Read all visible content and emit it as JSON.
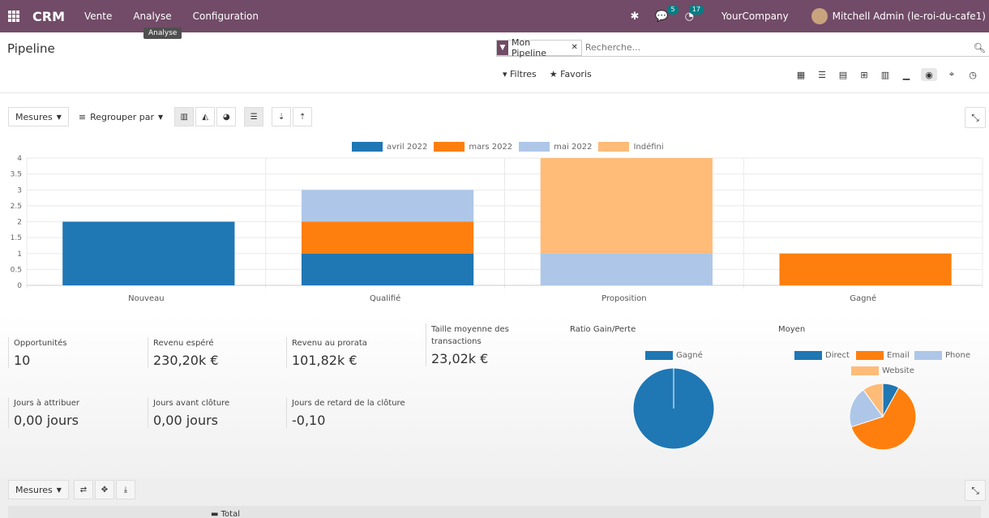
{
  "navbar": {
    "brand": "CRM",
    "menus": [
      "Vente",
      "Analyse",
      "Configuration"
    ],
    "messages_count": "5",
    "activities_count": "17",
    "company": "YourCompany",
    "user": "Mitchell Admin (le-roi-du-cafe1)"
  },
  "tooltip": "Analyse",
  "breadcrumb": "Pipeline",
  "search": {
    "facet": "Mon Pipeline",
    "placeholder": "Recherche..."
  },
  "filters": {
    "filtres": "Filtres",
    "favoris": "Favoris"
  },
  "graph_controls": {
    "mesures": "Mesures",
    "regrouper": "Regrouper par"
  },
  "colors": {
    "navbar": "#714b67",
    "avril": "#1f77b4",
    "mars": "#ff7f0e",
    "mai": "#aec7e8",
    "indefini": "#ffbb78"
  },
  "chart_data": {
    "type": "bar",
    "stacked": true,
    "categories": [
      "Nouveau",
      "Qualifié",
      "Proposition",
      "Gagné"
    ],
    "series": [
      {
        "name": "avril 2022",
        "values": [
          2,
          1,
          0,
          0
        ],
        "color": "#1f77b4"
      },
      {
        "name": "mars 2022",
        "values": [
          0,
          1,
          0,
          1
        ],
        "color": "#ff7f0e"
      },
      {
        "name": "mai 2022",
        "values": [
          0,
          1,
          1,
          0
        ],
        "color": "#aec7e8"
      },
      {
        "name": "Indéfini",
        "values": [
          0,
          0,
          3,
          0
        ],
        "color": "#ffbb78"
      }
    ],
    "ylim": [
      0,
      4
    ],
    "yticks": [
      "0",
      "0.5",
      "1",
      "1.5",
      "2",
      "2.5",
      "3",
      "3.5",
      "4"
    ],
    "grid": true,
    "legend": "top-center"
  },
  "kpis": [
    {
      "label": "Opportunités",
      "value": "10"
    },
    {
      "label": "Revenu espéré",
      "value": "230,20k €"
    },
    {
      "label": "Revenu au prorata",
      "value": "101,82k €"
    },
    {
      "label": "Taille moyenne des transactions",
      "value": "23,02k €"
    },
    {
      "label": "Jours à attribuer",
      "value": "0,00 jours"
    },
    {
      "label": "Jours avant clôture",
      "value": "0,00 jours"
    },
    {
      "label": "Jours de retard de la clôture",
      "value": "-0,10"
    }
  ],
  "ratio_chart": {
    "title": "Ratio Gain/Perte",
    "type": "pie",
    "legend": [
      "Gagné"
    ],
    "values": [
      1
    ],
    "colors": [
      "#1f77b4"
    ]
  },
  "medium_chart": {
    "title": "Moyen",
    "type": "pie",
    "legend": [
      "Direct",
      "Email",
      "Phone",
      "Website"
    ],
    "values": [
      8,
      62,
      20,
      10
    ],
    "colors": [
      "#1f77b4",
      "#ff7f0e",
      "#aec7e8",
      "#ffbb78"
    ]
  },
  "pivot": {
    "mesures": "Mesures",
    "total": "Total"
  }
}
